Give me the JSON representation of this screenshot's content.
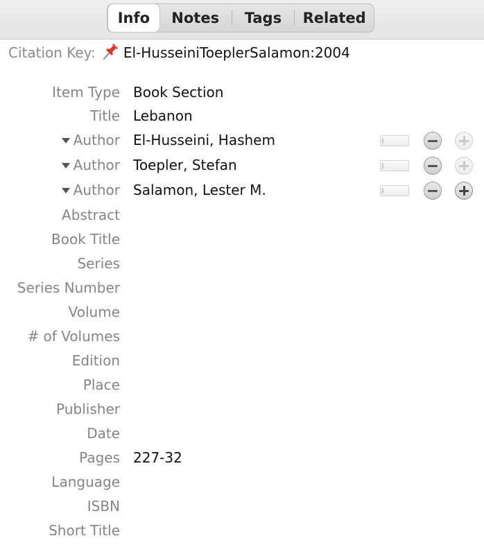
{
  "tabs": [
    {
      "label": "Info",
      "selected": true
    },
    {
      "label": "Notes",
      "selected": false
    },
    {
      "label": "Tags",
      "selected": false
    },
    {
      "label": "Related",
      "selected": false
    }
  ],
  "citation": {
    "label": "Citation Key:",
    "icon": "pushpin-icon",
    "value": "El-HusseiniToeplerSalamon:2004"
  },
  "fields": [
    {
      "label": "Item Type",
      "value": "Book Section"
    },
    {
      "label": "Title",
      "value": "Lebanon"
    },
    {
      "label": "Author",
      "value": "El-Husseini, Hashem",
      "creator": true,
      "plus_enabled": false
    },
    {
      "label": "Author",
      "value": "Toepler, Stefan",
      "creator": true,
      "plus_enabled": false
    },
    {
      "label": "Author",
      "value": "Salamon, Lester M.",
      "creator": true,
      "plus_enabled": true
    },
    {
      "label": "Abstract",
      "value": ""
    },
    {
      "label": "Book Title",
      "value": ""
    },
    {
      "label": "Series",
      "value": ""
    },
    {
      "label": "Series Number",
      "value": ""
    },
    {
      "label": "Volume",
      "value": ""
    },
    {
      "label": "# of Volumes",
      "value": ""
    },
    {
      "label": "Edition",
      "value": ""
    },
    {
      "label": "Place",
      "value": ""
    },
    {
      "label": "Publisher",
      "value": ""
    },
    {
      "label": "Date",
      "value": ""
    },
    {
      "label": "Pages",
      "value": "227-32"
    },
    {
      "label": "Language",
      "value": ""
    },
    {
      "label": "ISBN",
      "value": ""
    },
    {
      "label": "Short Title",
      "value": ""
    }
  ],
  "colors": {
    "label": "#858585",
    "value": "#111111",
    "pin": "#d9382e"
  }
}
